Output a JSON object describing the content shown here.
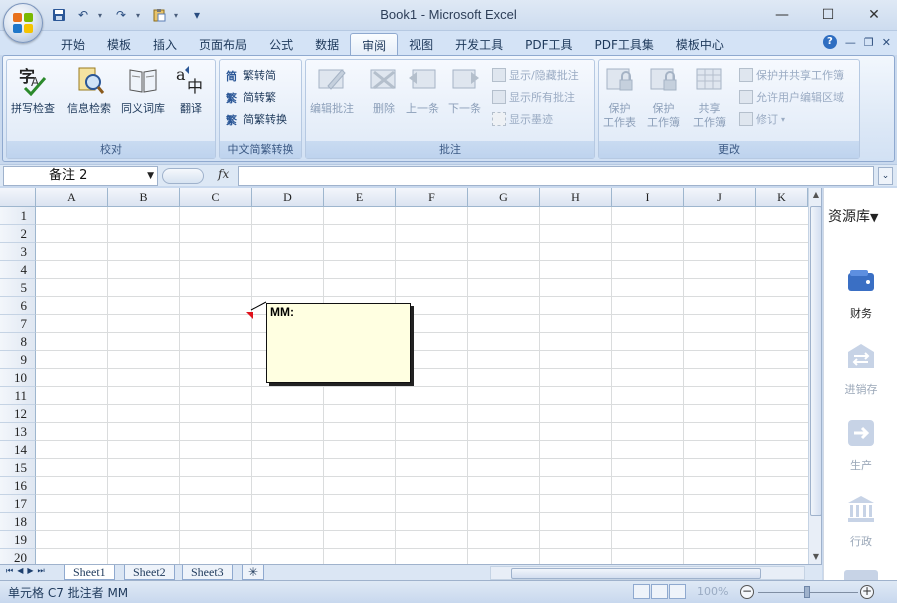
{
  "window": {
    "title": "Book1 - Microsoft Excel",
    "minimize": "—",
    "maximize": "☐",
    "close": "✕"
  },
  "qat": {
    "save_icon": "💾",
    "undo_icon": "↶",
    "redo_icon": "↷",
    "dropdown": "▾"
  },
  "tabs": [
    {
      "label": "开始",
      "active": false
    },
    {
      "label": "模板",
      "active": false
    },
    {
      "label": "插入",
      "active": false
    },
    {
      "label": "页面布局",
      "active": false
    },
    {
      "label": "公式",
      "active": false
    },
    {
      "label": "数据",
      "active": false
    },
    {
      "label": "审阅",
      "active": true
    },
    {
      "label": "视图",
      "active": false
    },
    {
      "label": "开发工具",
      "active": false
    },
    {
      "label": "PDF工具",
      "active": false
    },
    {
      "label": "PDF工具集",
      "active": false
    },
    {
      "label": "模板中心",
      "active": false
    }
  ],
  "tab_right": {
    "help": "?",
    "minimize": "—",
    "restore": "❐",
    "close": "✕"
  },
  "ribbon": {
    "proofing": {
      "label": "校对",
      "spell": "拼写检查",
      "research": "信息检索",
      "thesaurus": "同义词库",
      "translate": "翻译"
    },
    "chinese": {
      "label": "中文简繁转换",
      "to_simplified": "繁转简",
      "to_traditional": "简转繁",
      "convert": "简繁转换"
    },
    "comments": {
      "label": "批注",
      "edit": "编辑批注",
      "delete": "删除",
      "prev": "上一条",
      "next": "下一条",
      "show_hide": "显示/隐藏批注",
      "show_all": "显示所有批注",
      "show_ink": "显示墨迹"
    },
    "changes": {
      "label": "更改",
      "protect_sheet_1": "保护",
      "protect_sheet_2": "工作表",
      "protect_book_1": "保护",
      "protect_book_2": "工作簿",
      "share_1": "共享",
      "share_2": "工作簿",
      "protect_share": "保护并共享工作簿",
      "allow_edit": "允许用户编辑区域",
      "track": "修订"
    }
  },
  "formula_bar": {
    "name_box": "备注 2",
    "fx": "fx",
    "value": ""
  },
  "columns": [
    "A",
    "B",
    "C",
    "D",
    "E",
    "F",
    "G",
    "H",
    "I",
    "J",
    "K"
  ],
  "rows": [
    "1",
    "2",
    "3",
    "4",
    "5",
    "6",
    "7",
    "8",
    "9",
    "10",
    "11",
    "12",
    "13",
    "14",
    "15",
    "16",
    "17",
    "18",
    "19",
    "20"
  ],
  "comment": {
    "author": "MM:",
    "text": ""
  },
  "sheets": [
    {
      "label": "Sheet1",
      "active": true
    },
    {
      "label": "Sheet2",
      "active": false
    },
    {
      "label": "Sheet3",
      "active": false
    }
  ],
  "status": {
    "text": "单元格 C7 批注者 MM",
    "zoom": "100%"
  },
  "right_panel": {
    "title": "资源库",
    "items": [
      {
        "label": "财务",
        "enabled": true
      },
      {
        "label": "进销存",
        "enabled": false
      },
      {
        "label": "生产",
        "enabled": false
      },
      {
        "label": "行政",
        "enabled": false
      }
    ]
  }
}
